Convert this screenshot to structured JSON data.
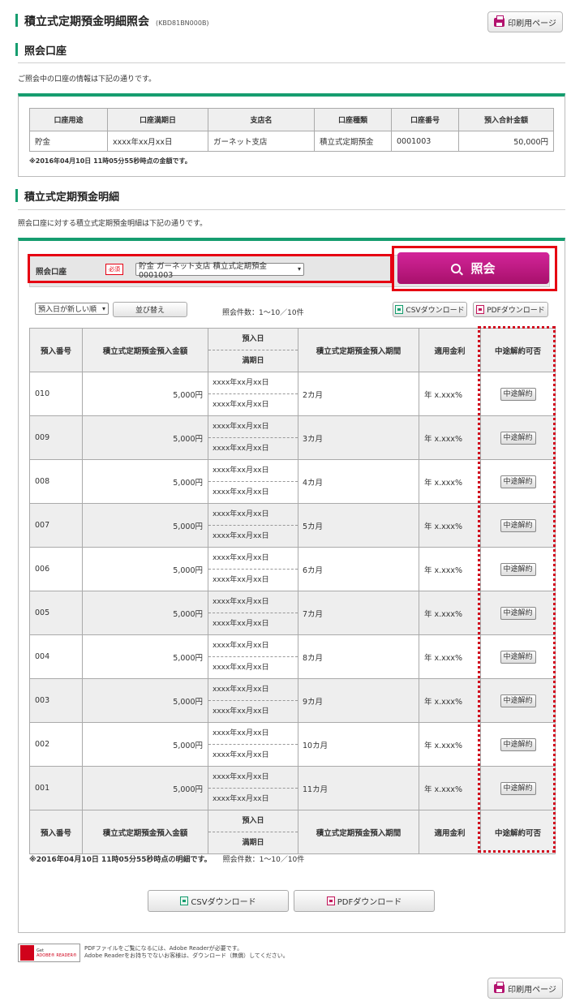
{
  "page": {
    "title": "積立式定期預金明細照会",
    "screen_id": "(KBD81BN000B)",
    "print_label": "印刷用ページ"
  },
  "account_section": {
    "title": "照会口座",
    "intro": "ご照会中の口座の情報は下記の通りです。",
    "headers": [
      "口座用途",
      "口座満期日",
      "支店名",
      "口座種類",
      "口座番号",
      "預入合計金額"
    ],
    "row": [
      "貯金",
      "xxxx年xx月xx日",
      "ガーネット支店",
      "積立式定期預金",
      "0001003",
      "50,000円"
    ],
    "note": "※2016年04月10日 11時05分55秒時点の金額です。"
  },
  "detail_section": {
    "title": "積立式定期預金明細",
    "intro": "照会口座に対する積立式定期預金明細は下記の通りです。"
  },
  "query": {
    "label": "照会口座",
    "required": "必須",
    "account_value": "貯金 ガーネット支店 積立式定期預金 0001003",
    "button": "照会"
  },
  "toolbar": {
    "sort_value": "預入日が新しい順",
    "sort_button": "並び替え",
    "count": "照会件数：1〜10／10件",
    "csv": "CSVダウンロード",
    "pdf": "PDFダウンロード"
  },
  "table": {
    "headers": {
      "no": "預入番号",
      "amount": "積立式定期預金預入金額",
      "deposit_date": "預入日",
      "maturity_date": "満期日",
      "period": "積立式定期預金預入期間",
      "rate": "適用金利",
      "cancel": "中途解約可否"
    },
    "rows": [
      {
        "no": "010",
        "amount": "5,000円",
        "d1": "xxxx年xx月xx日",
        "d2": "xxxx年xx月xx日",
        "period": "2カ月",
        "rate": "年 x.xxx%",
        "btn": "中途解約"
      },
      {
        "no": "009",
        "amount": "5,000円",
        "d1": "xxxx年xx月xx日",
        "d2": "xxxx年xx月xx日",
        "period": "3カ月",
        "rate": "年 x.xxx%",
        "btn": "中途解約"
      },
      {
        "no": "008",
        "amount": "5,000円",
        "d1": "xxxx年xx月xx日",
        "d2": "xxxx年xx月xx日",
        "period": "4カ月",
        "rate": "年 x.xxx%",
        "btn": "中途解約"
      },
      {
        "no": "007",
        "amount": "5,000円",
        "d1": "xxxx年xx月xx日",
        "d2": "xxxx年xx月xx日",
        "period": "5カ月",
        "rate": "年 x.xxx%",
        "btn": "中途解約"
      },
      {
        "no": "006",
        "amount": "5,000円",
        "d1": "xxxx年xx月xx日",
        "d2": "xxxx年xx月xx日",
        "period": "6カ月",
        "rate": "年 x.xxx%",
        "btn": "中途解約"
      },
      {
        "no": "005",
        "amount": "5,000円",
        "d1": "xxxx年xx月xx日",
        "d2": "xxxx年xx月xx日",
        "period": "7カ月",
        "rate": "年 x.xxx%",
        "btn": "中途解約"
      },
      {
        "no": "004",
        "amount": "5,000円",
        "d1": "xxxx年xx月xx日",
        "d2": "xxxx年xx月xx日",
        "period": "8カ月",
        "rate": "年 x.xxx%",
        "btn": "中途解約"
      },
      {
        "no": "003",
        "amount": "5,000円",
        "d1": "xxxx年xx月xx日",
        "d2": "xxxx年xx月xx日",
        "period": "9カ月",
        "rate": "年 x.xxx%",
        "btn": "中途解約"
      },
      {
        "no": "002",
        "amount": "5,000円",
        "d1": "xxxx年xx月xx日",
        "d2": "xxxx年xx月xx日",
        "period": "10カ月",
        "rate": "年 x.xxx%",
        "btn": "中途解約"
      },
      {
        "no": "001",
        "amount": "5,000円",
        "d1": "xxxx年xx月xx日",
        "d2": "xxxx年xx月xx日",
        "period": "11カ月",
        "rate": "年 x.xxx%",
        "btn": "中途解約"
      }
    ],
    "note": "※2016年04月10日 11時05分55秒時点の明細です。",
    "count": "照会件数：1〜10／10件"
  },
  "bottom": {
    "csv": "CSVダウンロード",
    "pdf": "PDFダウンロード"
  },
  "adobe": {
    "logo_line1": "Get",
    "logo_line2": "ADOBE® READER®",
    "text1": "PDFファイルをご覧になるには、Adobe Readerが必要です。",
    "text2": "Adobe Readerをお持ちでないお客様は、ダウンロード（無償）してください。"
  }
}
